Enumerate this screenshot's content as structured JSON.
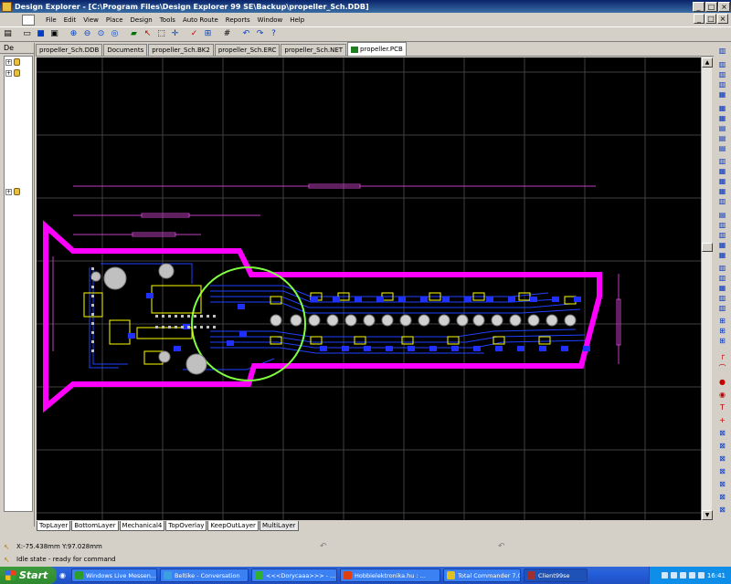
{
  "window": {
    "title": "Design Explorer - [C:\\Program Files\\Design Explorer 99 SE\\Backup\\propeller_Sch.DDB]",
    "min": "_",
    "max": "□",
    "close": "×"
  },
  "menu": {
    "items": [
      "File",
      "Edit",
      "View",
      "Place",
      "Design",
      "Tools",
      "Auto Route",
      "Reports",
      "Window",
      "Help"
    ]
  },
  "toolbar": {
    "icons": [
      "design-manager-icon",
      "open-icon",
      "save-icon",
      "print-icon",
      "zoom-in-icon",
      "zoom-out-icon",
      "zoom-area-icon",
      "zoom-fit-icon",
      "browse-icon",
      "select-icon",
      "cross-probe-icon",
      "move-icon",
      "place-icon",
      "route-icon",
      "undo-icon",
      "redo-icon",
      "help-icon"
    ]
  },
  "left_panel": {
    "header": "De",
    "tree_nodes": [
      "+",
      "+",
      "+"
    ]
  },
  "doc_tabs": [
    {
      "label": "propeller_Sch.DDB",
      "active": false
    },
    {
      "label": "Documents",
      "active": false
    },
    {
      "label": "propeller_Sch.BK2",
      "active": false
    },
    {
      "label": "propeller_Sch.ERC",
      "active": false
    },
    {
      "label": "propeller_Sch.NET",
      "active": false
    },
    {
      "label": "propeller.PCB",
      "active": true
    }
  ],
  "layer_tabs": [
    {
      "label": "TopLayer",
      "active": false
    },
    {
      "label": "BottomLayer",
      "active": false
    },
    {
      "label": "Mechanical4",
      "active": false
    },
    {
      "label": "TopOverlay",
      "active": false
    },
    {
      "label": "KeepOutLayer",
      "active": false
    },
    {
      "label": "MultiLayer",
      "active": true
    }
  ],
  "status": {
    "coords": "X:-75.438mm Y:97.028mm",
    "state": "Idle state - ready for command"
  },
  "colors": {
    "board_outline": "#ff00ff",
    "propeller_circle": "#80ff40",
    "grid": "#404040",
    "bottom_traces": "#2040ff",
    "top_overlay": "#ffff00",
    "pads": "#c0c0c0"
  },
  "taskbar": {
    "start": "Start",
    "tasks": [
      {
        "label": "Windows Live Messen...",
        "icon_color": "#2a9d2a",
        "active": false
      },
      {
        "label": "Beltike - Conversation",
        "icon_color": "#3aa0e0",
        "active": false
      },
      {
        "label": "<<<Dorycaaa>>> - ...",
        "icon_color": "#30b030",
        "active": false
      },
      {
        "label": "Hobbielektronika.hu : ...",
        "icon_color": "#e04010",
        "active": false
      },
      {
        "label": "Total Commander 7.0...",
        "icon_color": "#e0c020",
        "active": false
      },
      {
        "label": "Client99se",
        "icon_color": "#a03030",
        "active": true
      }
    ],
    "clock": "16:41"
  }
}
